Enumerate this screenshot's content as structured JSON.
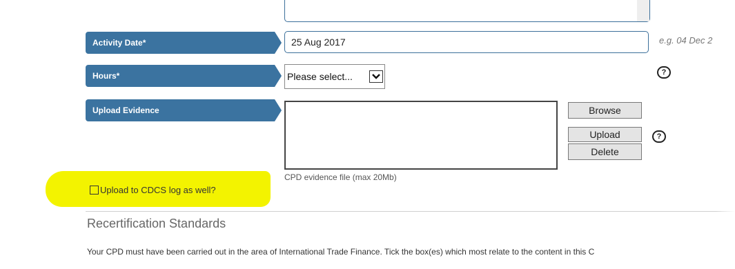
{
  "form": {
    "activity_date": {
      "label": "Activity Date*",
      "value": "25 Aug 2017",
      "hint": "e.g. 04 Dec 2"
    },
    "hours": {
      "label": "Hours*",
      "selected": "Please select..."
    },
    "upload_evidence": {
      "label": "Upload Evidence",
      "browse_label": "Browse",
      "upload_label": "Upload",
      "delete_label": "Delete",
      "caption": "CPD evidence file (max 20Mb)"
    },
    "cdcs_checkbox": {
      "label": "Upload to CDCS log as well?",
      "checked": false
    }
  },
  "recertification": {
    "title": "Recertification Standards",
    "description": "Your CPD must have been carried out in the area of International Trade Finance. Tick the box(es) which most relate to the content in this C"
  },
  "icons": {
    "help": "?"
  },
  "colors": {
    "label_tab": "#3b73a0",
    "highlight": "#f3f300"
  }
}
